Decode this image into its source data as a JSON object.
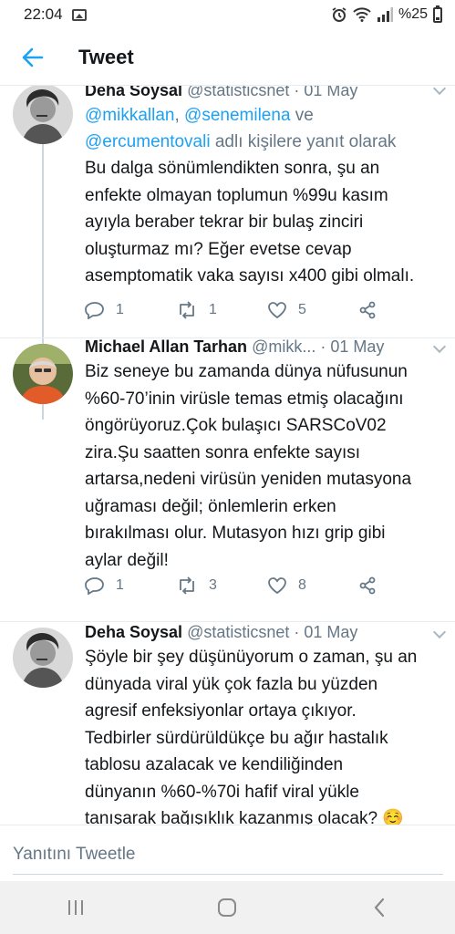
{
  "status_bar": {
    "time": "22:04",
    "battery_text": "%25"
  },
  "header": {
    "title": "Tweet"
  },
  "tweets": [
    {
      "name": "Deha Soysal",
      "handle": "@statisticsnet",
      "date": "01 May",
      "replying_to": [
        "@mikkallan",
        "@senemilena",
        "@ercumentovali"
      ],
      "reply_to_joiner": "ve",
      "reply_to_suffix": "adlı kişilere yanıt olarak",
      "text_lines": [
        "Bu dalga sönümlendikten sonra, şu an",
        "enfekte olmayan toplumun %99u kasım",
        "ayıyla beraber tekrar bir bulaş zinciri",
        "oluşturmaz mı? Eğer evetse cevap",
        "asemptomatik vaka sayısı x400 gibi olmalı."
      ],
      "replies": "1",
      "retweets": "1",
      "likes": "5"
    },
    {
      "name": "Michael Allan Tarhan",
      "handle": "@mikk...",
      "date": "01 May",
      "text_lines": [
        "Biz seneye bu zamanda dünya nüfusunun",
        "%60-70’inin virüsle temas etmiş olacağını",
        "öngörüyoruz.Çok bulaşıcı SARSCoV02",
        "zira.Şu saatten sonra enfekte sayısı",
        "artarsa,nedeni virüsün yeniden mutasyona",
        "uğraması değil; önlemlerin erken",
        "bırakılması olur. Mutasyon hızı grip gibi",
        "aylar değil!"
      ],
      "replies": "1",
      "retweets": "3",
      "likes": "8"
    },
    {
      "name": "Deha Soysal",
      "handle": "@statisticsnet",
      "date": "01 May",
      "text_lines": [
        "Şöyle bir şey düşünüyorum o zaman, şu an",
        "dünyada viral yük çok fazla bu yüzden",
        "agresif enfeksiyonlar ortaya çıkıyor.",
        "Tedbirler sürdürüldükçe bu ağır hastalık",
        "tablosu azalacak ve kendiliğinden",
        "dünyanın %60-%70i hafif viral yükle",
        "tanışarak bağışıklık kazanmış olacak? ☺️"
      ]
    }
  ],
  "reply_bar": {
    "placeholder": "Yanıtını Tweetle"
  },
  "nav": {
    "recents_icon": "recents-icon",
    "home_icon": "home-icon",
    "back_icon": "back-icon"
  }
}
